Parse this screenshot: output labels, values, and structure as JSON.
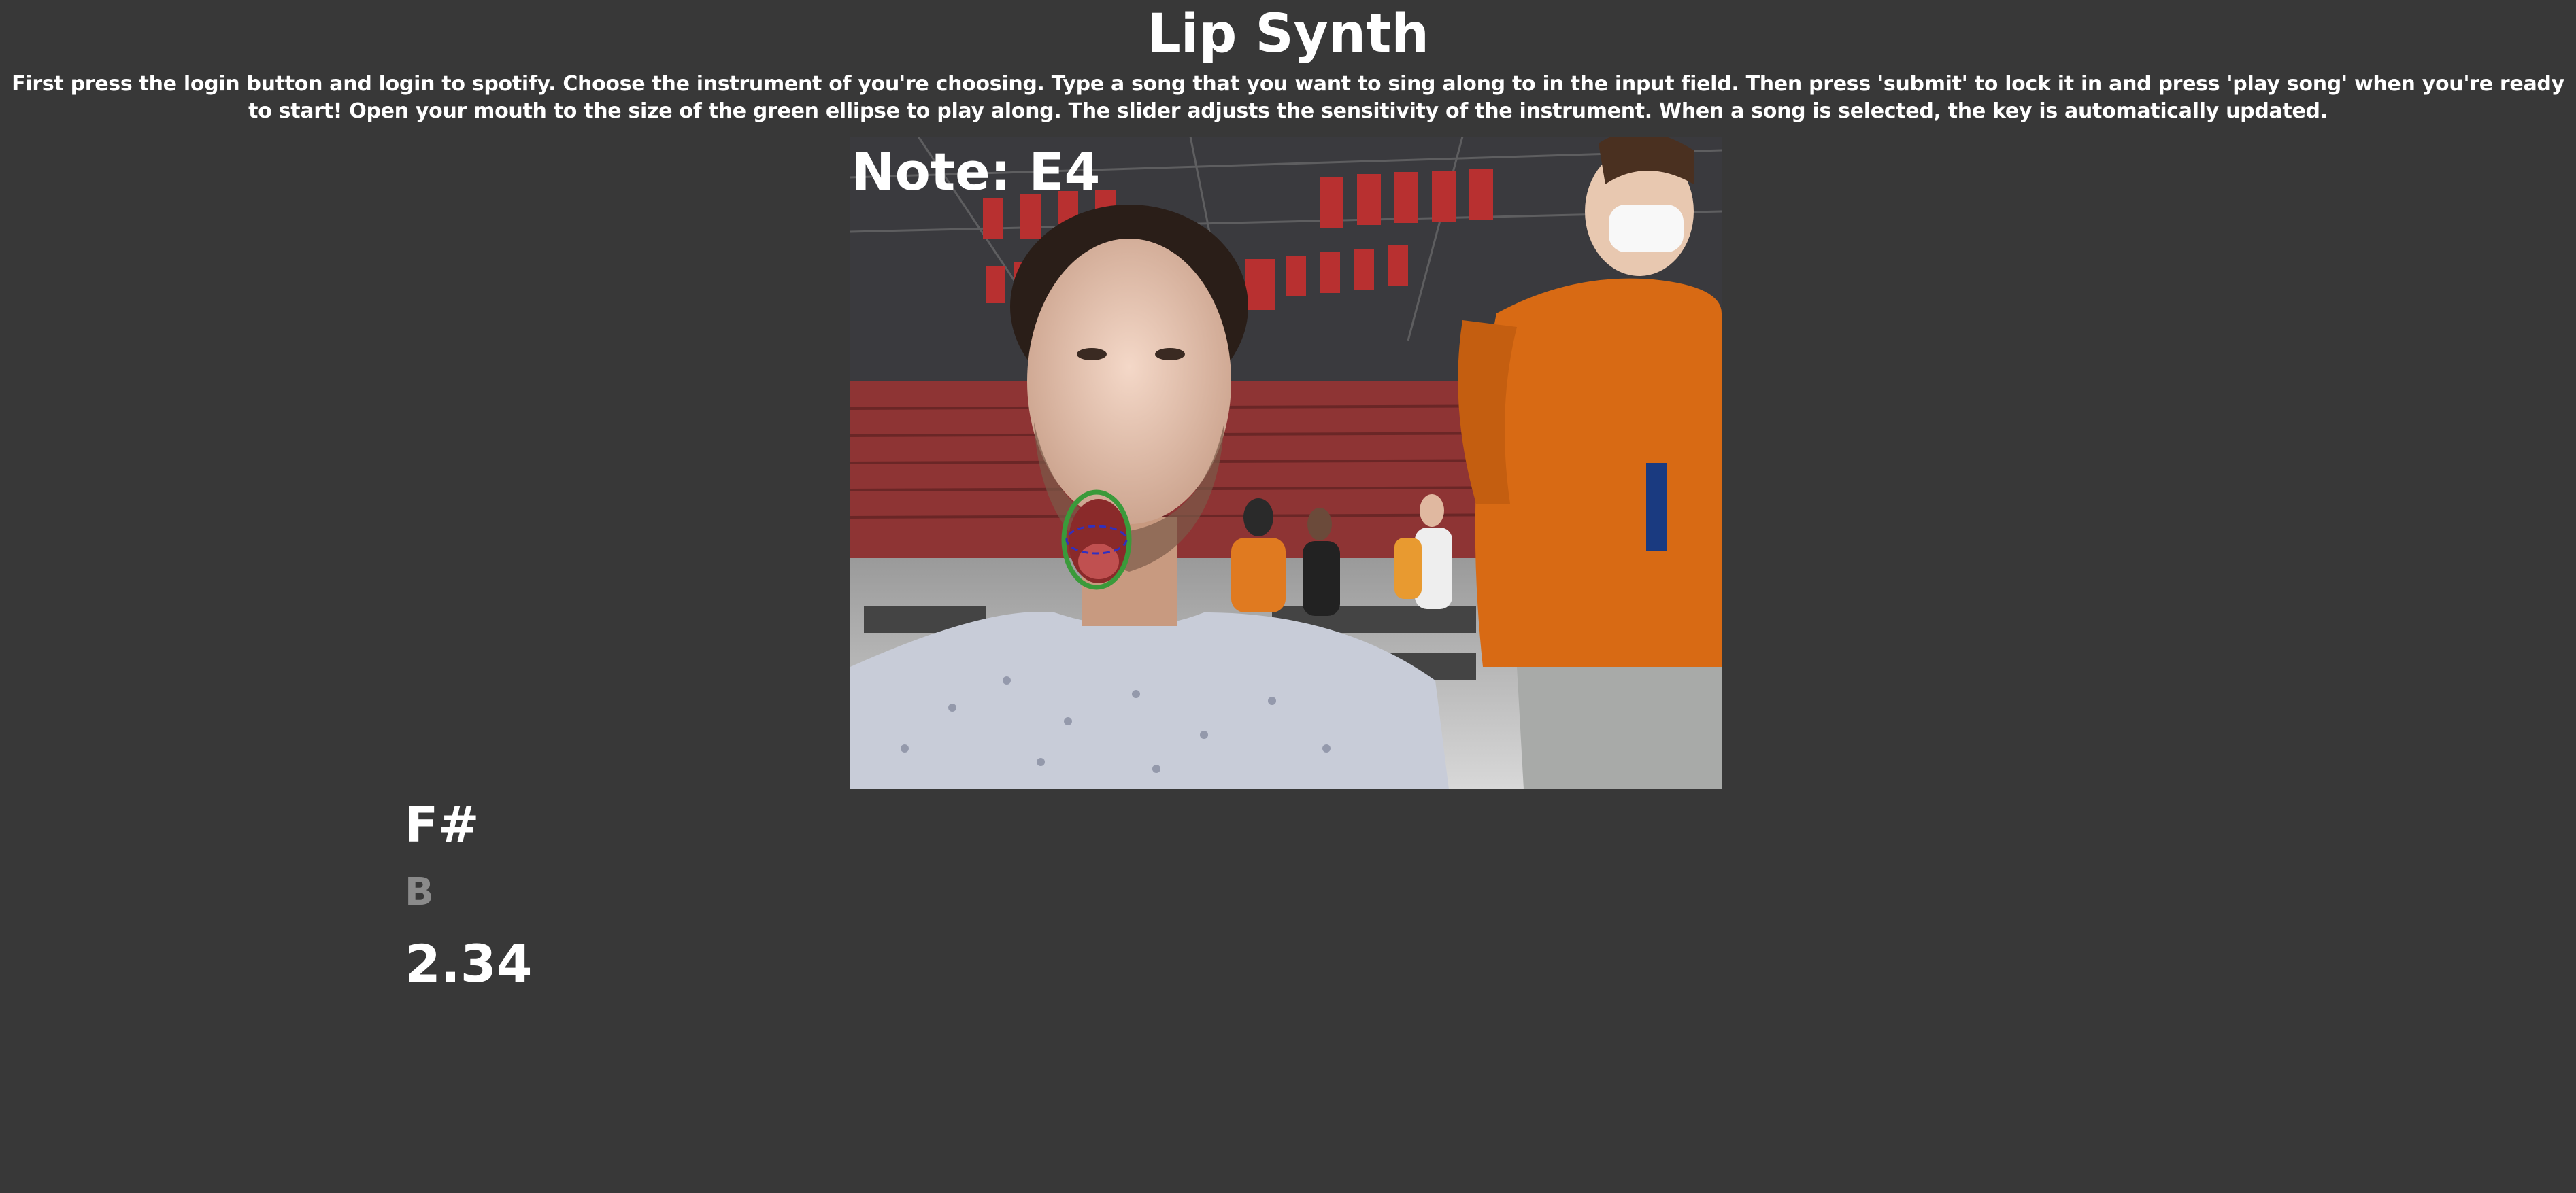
{
  "header": {
    "title": "Lip Synth",
    "instructions": "First press the login button and login to spotify. Choose the instrument of you're choosing. Type a song that you want to sing along to in the input field. Then press 'submit' to lock it in and press 'play song' when you're ready to start! Open your mouth to the size of the green ellipse to play along. The slider adjusts the sensitivity of the instrument. When a song is selected, the key is automatically updated."
  },
  "video": {
    "note_text": "Note: E4",
    "target_ellipse_color": "#3a9a3a",
    "mouth_ellipse_color": "#3030c0"
  },
  "readouts": {
    "key": "F#",
    "secondary_key": "B",
    "value": "2.34"
  },
  "colors": {
    "background": "#383838",
    "text": "#ffffff",
    "muted_text": "#8a8a8a"
  }
}
